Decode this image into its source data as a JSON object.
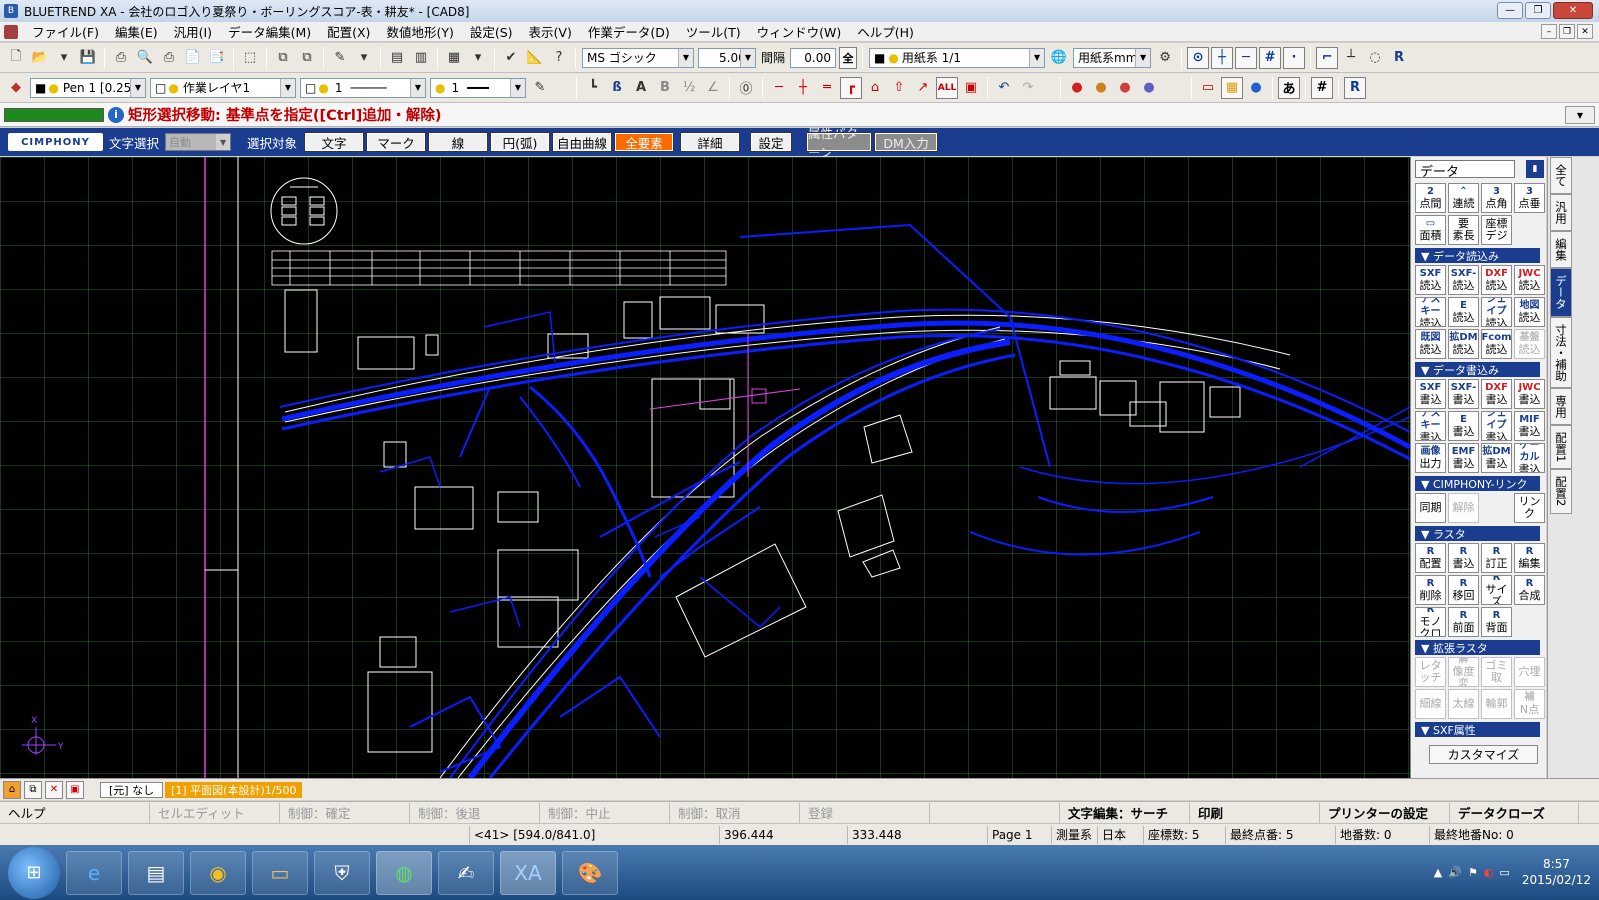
{
  "window": {
    "title": "BLUETREND XA - 会社のロゴ入り夏祭り・ボーリングスコア-表・耕友* - [CAD8]",
    "buttons": [
      "—",
      "❐",
      "✕"
    ]
  },
  "menu": [
    "ファイル(F)",
    "編集(E)",
    "汎用(I)",
    "データ編集(M)",
    "配置(X)",
    "数値地形(Y)",
    "設定(S)",
    "表示(V)",
    "作業データ(D)",
    "ツール(T)",
    "ウィンドウ(W)",
    "ヘルプ(H)"
  ],
  "toolbar1": {
    "font": "MS ゴシック",
    "size": "5.00",
    "spacing_label": "間隔",
    "spacing": "0.00",
    "all": "全",
    "paper": "用紙系 1/1",
    "unit": "用紙系mm"
  },
  "toolbar2": {
    "pen": "Pen 1 [0.25]",
    "layer": "作業レイヤ1",
    "linetype": "1",
    "linewidth": "1"
  },
  "message": {
    "text": "矩形選択移動: 基準点を指定([Ctrl]追加・解除)"
  },
  "selbar": {
    "logo": "CIMPHONY",
    "text_select_label": "文字選択",
    "auto": "自動",
    "target_label": "選択対象",
    "buttons": [
      "文字",
      "マーク",
      "線",
      "円(弧)",
      "自由曲線",
      "全要素",
      "詳細",
      "設定"
    ],
    "attr_pattern": "属性パターン",
    "dm_input": "DM入力"
  },
  "panel": {
    "title": "データ",
    "top_buttons": [
      {
        "top": "2",
        "bottom": "点間"
      },
      {
        "top": "",
        "bottom": "連続"
      },
      {
        "top": "3",
        "bottom": "点角"
      },
      {
        "top": "3",
        "bottom": "点垂"
      },
      {
        "top": "",
        "bottom": "面積"
      },
      {
        "top": "要",
        "bottom": "素長"
      },
      {
        "top": "座標",
        "bottom": "デジ"
      }
    ],
    "sections": [
      {
        "label": "▼ データ読込み",
        "buttons": [
          {
            "top": "SXF",
            "bottom": "読込",
            "cls": ""
          },
          {
            "top": "SXF-",
            "bottom": "読込",
            "cls": ""
          },
          {
            "top": "DXF",
            "bottom": "読込",
            "cls": "dxf"
          },
          {
            "top": "JWC",
            "bottom": "読込",
            "cls": "jwc"
          },
          {
            "top": "アスキー",
            "bottom": "読込",
            "cls": ""
          },
          {
            "top": "E",
            "bottom": "読込",
            "cls": ""
          },
          {
            "top": "シェイプ",
            "bottom": "読込",
            "cls": ""
          },
          {
            "top": "地図",
            "bottom": "読込",
            "cls": ""
          },
          {
            "top": "既図",
            "bottom": "読込",
            "cls": ""
          },
          {
            "top": "拡DM",
            "bottom": "読込",
            "cls": ""
          },
          {
            "top": "Fcom",
            "bottom": "読込",
            "cls": ""
          },
          {
            "top": "基盤",
            "bottom": "読込",
            "cls": "dis"
          }
        ]
      },
      {
        "label": "▼ データ書込み",
        "buttons": [
          {
            "top": "SXF",
            "bottom": "書込",
            "cls": ""
          },
          {
            "top": "SXF-",
            "bottom": "書込",
            "cls": ""
          },
          {
            "top": "DXF",
            "bottom": "書込",
            "cls": "dxf"
          },
          {
            "top": "JWC",
            "bottom": "書込",
            "cls": "jwc"
          },
          {
            "top": "アスキー",
            "bottom": "書込",
            "cls": ""
          },
          {
            "top": "E",
            "bottom": "書込",
            "cls": ""
          },
          {
            "top": "シェイプ",
            "bottom": "書込",
            "cls": ""
          },
          {
            "top": "MIF",
            "bottom": "書込",
            "cls": ""
          },
          {
            "top": "画像",
            "bottom": "出力",
            "cls": ""
          },
          {
            "top": "EMF",
            "bottom": "書込",
            "cls": ""
          },
          {
            "top": "拡DM",
            "bottom": "書込",
            "cls": ""
          },
          {
            "top": "ゲーカル",
            "bottom": "書込",
            "cls": ""
          }
        ]
      },
      {
        "label": "▼ CIMPHONY-リンク",
        "buttons": [
          {
            "top": "",
            "bottom": "同期",
            "cls": ""
          },
          {
            "top": "",
            "bottom": "解除",
            "cls": "dis"
          },
          {
            "top": "",
            "bottom": "",
            "cls": "empty"
          },
          {
            "top": "",
            "bottom": "リンク",
            "cls": ""
          }
        ]
      },
      {
        "label": "▼ ラスタ",
        "buttons": [
          {
            "top": "R",
            "bottom": "配置",
            "cls": ""
          },
          {
            "top": "R",
            "bottom": "書込",
            "cls": ""
          },
          {
            "top": "R",
            "bottom": "訂正",
            "cls": ""
          },
          {
            "top": "R",
            "bottom": "編集",
            "cls": ""
          },
          {
            "top": "R",
            "bottom": "削除",
            "cls": ""
          },
          {
            "top": "R",
            "bottom": "移回",
            "cls": ""
          },
          {
            "top": "R",
            "bottom": "サイズ",
            "cls": ""
          },
          {
            "top": "R",
            "bottom": "合成",
            "cls": ""
          },
          {
            "top": "R",
            "bottom": "モノクロ",
            "cls": ""
          },
          {
            "top": "R",
            "bottom": "前面",
            "cls": ""
          },
          {
            "top": "R",
            "bottom": "背面",
            "cls": ""
          },
          {
            "top": "",
            "bottom": "",
            "cls": "empty"
          }
        ]
      },
      {
        "label": "▼ 拡張ラスタ",
        "buttons": [
          {
            "top": "",
            "bottom": "レタッチ",
            "cls": "dis"
          },
          {
            "top": "解",
            "bottom": "像度変",
            "cls": "dis"
          },
          {
            "top": "",
            "bottom": "ゴミ取",
            "cls": "dis"
          },
          {
            "top": "",
            "bottom": "穴埋",
            "cls": "dis"
          },
          {
            "top": "",
            "bottom": "細線",
            "cls": "dis"
          },
          {
            "top": "",
            "bottom": "太線",
            "cls": "dis"
          },
          {
            "top": "",
            "bottom": "輪郭",
            "cls": "dis"
          },
          {
            "top": "補",
            "bottom": "N点",
            "cls": "dis"
          }
        ]
      },
      {
        "label": "▼ SXF属性",
        "buttons": []
      }
    ],
    "customize": "カスタマイズ"
  },
  "side_tabs": [
    "全て",
    "汎用",
    "編集",
    "データ",
    "寸法・補助",
    "専用",
    "配置1",
    "配置2"
  ],
  "active_side_tab": 3,
  "tabstrip": {
    "tab1": "[元] なし",
    "tab2": "[1] 平面図(本設計)1/500"
  },
  "funcbar": [
    {
      "label": "ヘルプ",
      "cls": ""
    },
    {
      "label": "セルエディット",
      "cls": "dis"
    },
    {
      "label": "制御：確定",
      "cls": "dis"
    },
    {
      "label": "制御：後退",
      "cls": "dis"
    },
    {
      "label": "制御：中止",
      "cls": "dis"
    },
    {
      "label": "制御：取消",
      "cls": "dis"
    },
    {
      "label": "登録",
      "cls": "dis"
    },
    {
      "label": "",
      "cls": ""
    },
    {
      "label": "文字編集：サーチ",
      "cls": "bold"
    },
    {
      "label": "印刷",
      "cls": "bold"
    },
    {
      "label": "プリンターの設定",
      "cls": "bold"
    },
    {
      "label": "データクローズ",
      "cls": "bold"
    }
  ],
  "status": {
    "sheet": "<41> [594.0/841.0]",
    "x": "396.444",
    "y": "333.448",
    "page": "Page  1",
    "coord_system": "測量系",
    "country": "日本",
    "coord_count": "座標数:   5",
    "last_point": "最終点番:   5",
    "lot_count": "地番数:   0",
    "last_lot": "最終地番No:   0"
  },
  "taskbar": {
    "time": "8:57",
    "date": "2015/02/12"
  },
  "canvas": {
    "axis_x": "X",
    "axis_y": "Y"
  }
}
